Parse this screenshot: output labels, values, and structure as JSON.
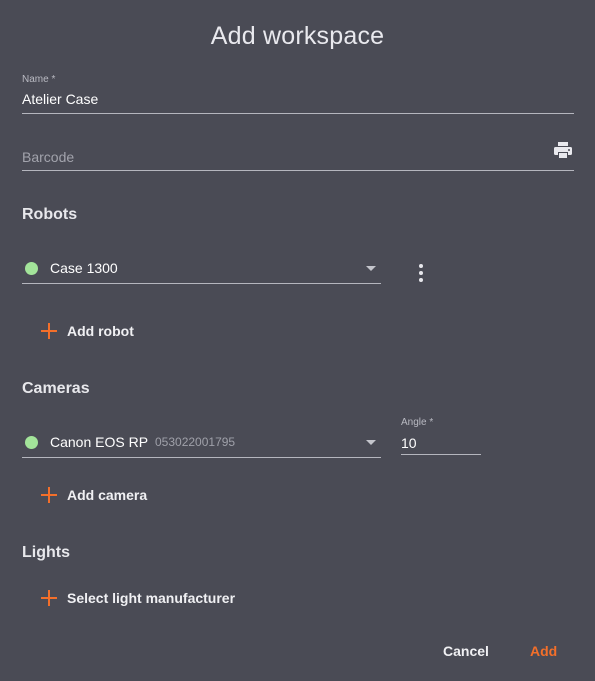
{
  "dialog": {
    "title": "Add workspace"
  },
  "name_field": {
    "label": "Name *",
    "value": "Atelier Case"
  },
  "barcode_field": {
    "placeholder": "Barcode",
    "icon": "printer-icon"
  },
  "robots": {
    "heading": "Robots",
    "items": [
      {
        "name": "Case 1300",
        "status_color": "#a3e49a"
      }
    ],
    "add_label": "Add robot"
  },
  "cameras": {
    "heading": "Cameras",
    "items": [
      {
        "name": "Canon EOS RP",
        "serial": "053022001795",
        "status_color": "#a3e49a",
        "angle_label": "Angle *",
        "angle_value": "10"
      }
    ],
    "add_label": "Add camera"
  },
  "lights": {
    "heading": "Lights",
    "add_label": "Select light manufacturer"
  },
  "actions": {
    "cancel": "Cancel",
    "add": "Add"
  },
  "colors": {
    "accent": "#f36f2a",
    "status_online": "#a3e49a",
    "background": "#4a4b55"
  }
}
